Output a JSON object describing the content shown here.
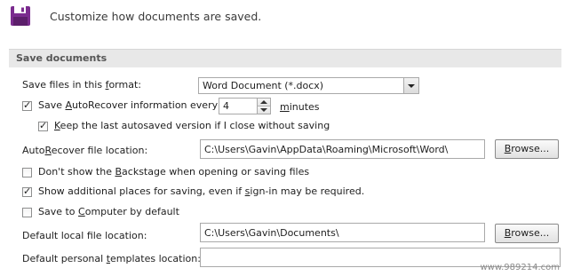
{
  "header": {
    "text": "Customize how documents are saved."
  },
  "section": {
    "title": "Save documents"
  },
  "format": {
    "label": "Save files in this format:",
    "value": "Word Document (*.docx)"
  },
  "autorecover": {
    "label": "Save AutoRecover information every",
    "value": "4",
    "unit": "minutes",
    "checked": true
  },
  "keep_last": {
    "label": "Keep the last autosaved version if I close without saving",
    "checked": true
  },
  "autorecover_location": {
    "label": "AutoRecover file location:",
    "value": "C:\\Users\\Gavin\\AppData\\Roaming\\Microsoft\\Word\\",
    "button": "Browse..."
  },
  "backstage": {
    "label": "Don't show the Backstage when opening or saving files",
    "checked": false
  },
  "additional_places": {
    "label": "Show additional places for saving, even if sign-in may be required.",
    "checked": true
  },
  "save_to_computer": {
    "label": "Save to Computer by default",
    "checked": false
  },
  "default_local": {
    "label": "Default local file location:",
    "value": "C:\\Users\\Gavin\\Documents\\",
    "button": "Browse..."
  },
  "default_templates": {
    "label": "Default personal templates location:",
    "value": ""
  },
  "watermark": "www.989214.com",
  "colors": {
    "icon_purple": "#7b2c8f",
    "section_band": "#e8e8e8"
  },
  "icons": {
    "header": "save-disk-icon"
  }
}
